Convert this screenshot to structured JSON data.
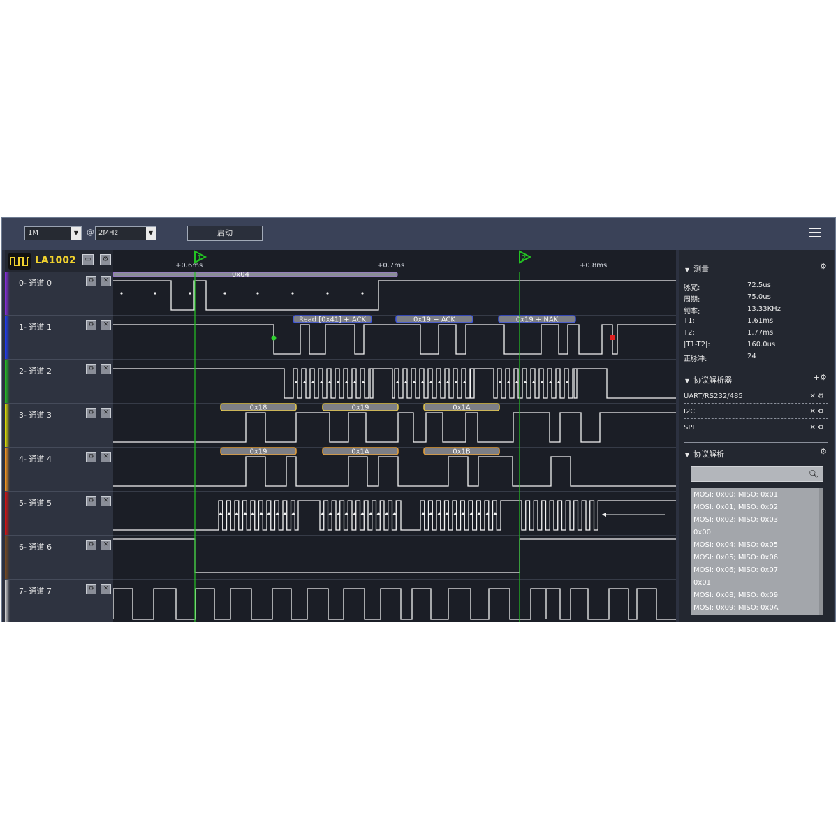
{
  "toolbar": {
    "depth_value": "1M",
    "at_symbol": "@",
    "rate_value": "2MHz",
    "start_label": "启动"
  },
  "device": {
    "name": "LA1002"
  },
  "ruler": {
    "ticks": [
      "+0.6ms",
      "+0.7ms",
      "+0.8ms"
    ],
    "cursor1": "1",
    "cursor2": "2"
  },
  "channels": [
    {
      "label": "0- 通道 0",
      "color": "#8a2be2"
    },
    {
      "label": "1- 通道 1",
      "color": "#1e3cff"
    },
    {
      "label": "2- 通道 2",
      "color": "#22c522"
    },
    {
      "label": "3- 通道 3",
      "color": "#e6e600"
    },
    {
      "label": "4- 通道 4",
      "color": "#ff9a1e"
    },
    {
      "label": "5- 通道 5",
      "color": "#e01010"
    },
    {
      "label": "6- 通道 6",
      "color": "#7a4a1e"
    },
    {
      "label": "7- 通道 7",
      "color": "#d8d8d8"
    }
  ],
  "decodes": {
    "ch0_bar": "0x04",
    "ch1_bars": [
      "Read [0x41] + ACK",
      "0x19 + ACK",
      "0x19 + NAK"
    ],
    "ch3_bars": [
      "0x18",
      "0x19",
      "0x1A"
    ],
    "ch4_bars": [
      "0x19",
      "0x1A",
      "0x1B"
    ]
  },
  "measurement": {
    "title": "测量",
    "rows": [
      {
        "k": "脉宽:",
        "v": "72.5us"
      },
      {
        "k": "周期:",
        "v": "75.0us"
      },
      {
        "k": "频率:",
        "v": "13.33KHz"
      },
      {
        "k": "T1:",
        "v": "1.61ms"
      },
      {
        "k": "T2:",
        "v": "1.77ms"
      },
      {
        "k": "|T1-T2|:",
        "v": "160.0us"
      },
      {
        "k": "正脉冲:",
        "v": "24"
      }
    ]
  },
  "analyzers": {
    "title": "协议解析器",
    "items": [
      "UART/RS232/485",
      "I2C",
      "SPI"
    ]
  },
  "protocol": {
    "title": "协议解析",
    "search_placeholder": "",
    "results": [
      "MOSI: 0x00;  MISO: 0x01",
      "MOSI: 0x01;  MISO: 0x02",
      "MOSI: 0x02;  MISO: 0x03",
      "0x00",
      "MOSI: 0x04;  MISO: 0x05",
      "MOSI: 0x05;  MISO: 0x06",
      "MOSI: 0x06;  MISO: 0x07",
      "0x01",
      "MOSI: 0x08;  MISO: 0x09",
      "MOSI: 0x09;  MISO: 0x0A"
    ]
  },
  "colors": {
    "trace": "#f2f2f2",
    "cursor": "#23c423",
    "bg_wave": "#1b1e26"
  }
}
